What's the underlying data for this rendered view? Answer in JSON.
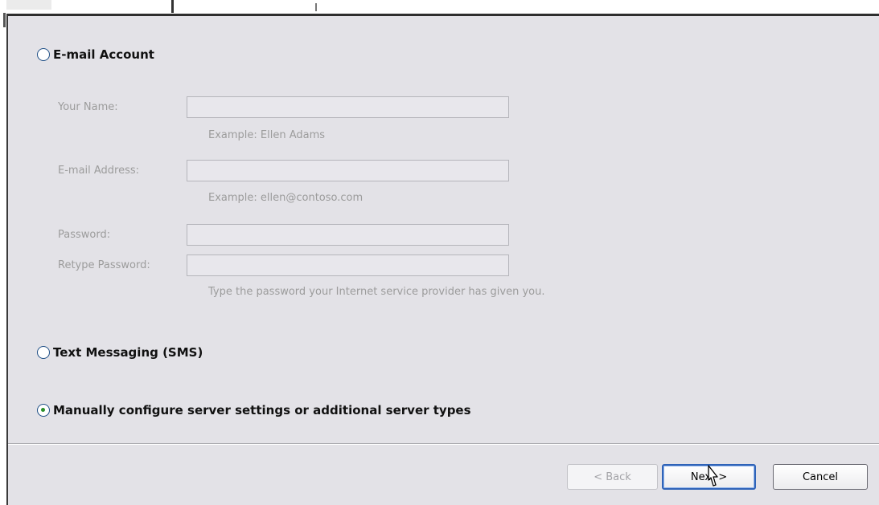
{
  "options": {
    "email_account": {
      "label": "E-mail Account",
      "selected": false
    },
    "sms": {
      "label": "Text Messaging (SMS)",
      "selected": false
    },
    "manual": {
      "label": "Manually configure server settings or additional server types",
      "selected": true
    }
  },
  "fields": {
    "your_name": {
      "label": "Your Name:",
      "value": "",
      "hint": "Example: Ellen Adams"
    },
    "email_address": {
      "label": "E-mail Address:",
      "value": "",
      "hint": "Example: ellen@contoso.com"
    },
    "password": {
      "label": "Password:",
      "value": ""
    },
    "retype_password": {
      "label": "Retype Password:",
      "value": "",
      "hint": "Type the password your Internet service provider has given you."
    }
  },
  "buttons": {
    "back": "< Back",
    "next": "Next >",
    "cancel": "Cancel"
  },
  "colors": {
    "dialog_bg": "#e3e2e7",
    "disabled_text": "#9c9c9c",
    "default_button_border": "#2f63b8",
    "radio_dot": "#2a8f2a"
  }
}
